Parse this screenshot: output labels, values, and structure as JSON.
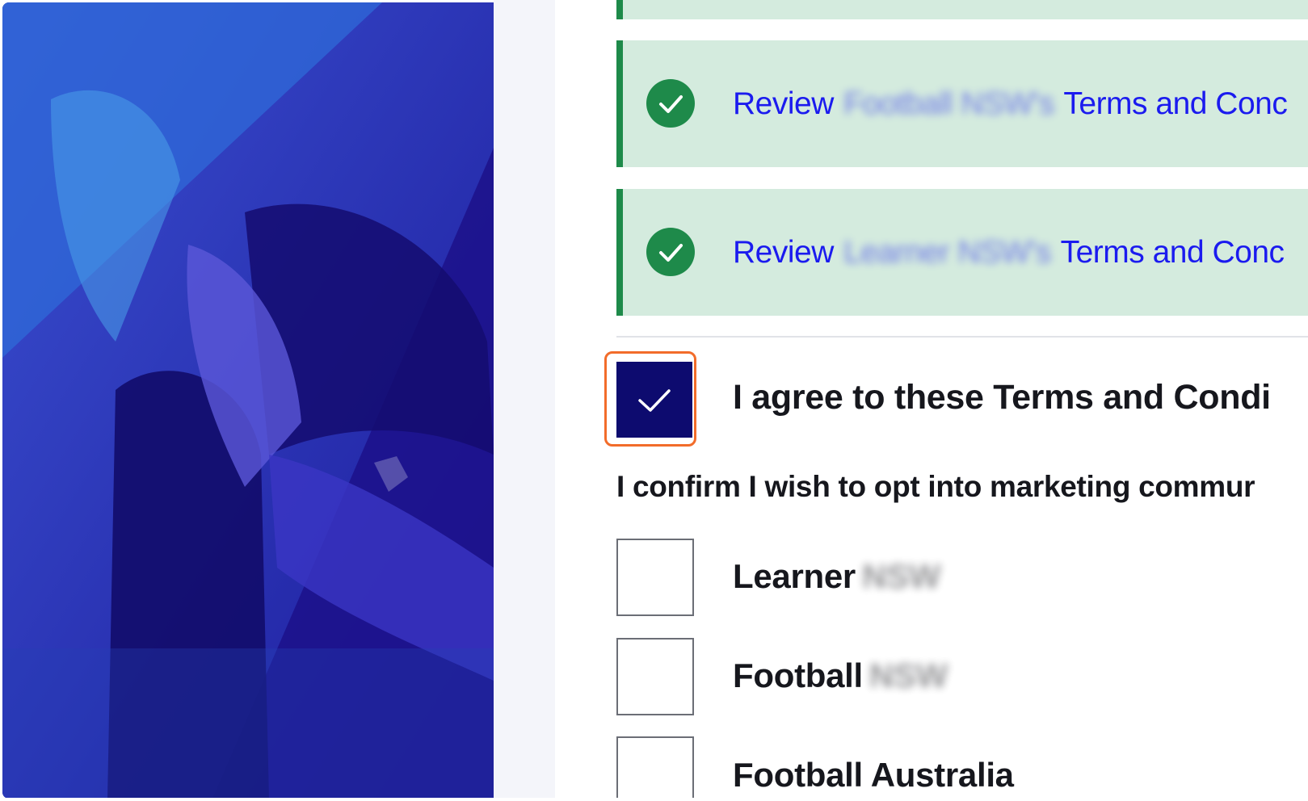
{
  "review_rows": [
    {
      "prefix": "Review",
      "blurred_org": "Football NSW's",
      "suffix": "Terms and Conc"
    },
    {
      "prefix": "Review",
      "blurred_org": "Learner NSW's",
      "suffix": "Terms and Conc"
    }
  ],
  "agree": {
    "label": "I agree to these Terms and Condi",
    "checked": true
  },
  "marketing": {
    "prompt": "I confirm I wish to opt into marketing commur",
    "options": [
      {
        "label": "Learner",
        "blurred": "NSW",
        "checked": false
      },
      {
        "label": "Football",
        "blurred": "NSW",
        "checked": false
      },
      {
        "label": "Football Australia",
        "blurred": "",
        "checked": false
      }
    ]
  },
  "colors": {
    "success_green": "#1e8a4a",
    "review_bg": "#d4ebde",
    "link_blue": "#1b1bef",
    "checkbox_navy": "#0d0b6f",
    "highlight_orange": "#f26c2a",
    "hero_blue": "#2a2fb4"
  },
  "icons": {
    "review_status": "check-circle-icon",
    "agree_check": "checkmark-icon"
  }
}
